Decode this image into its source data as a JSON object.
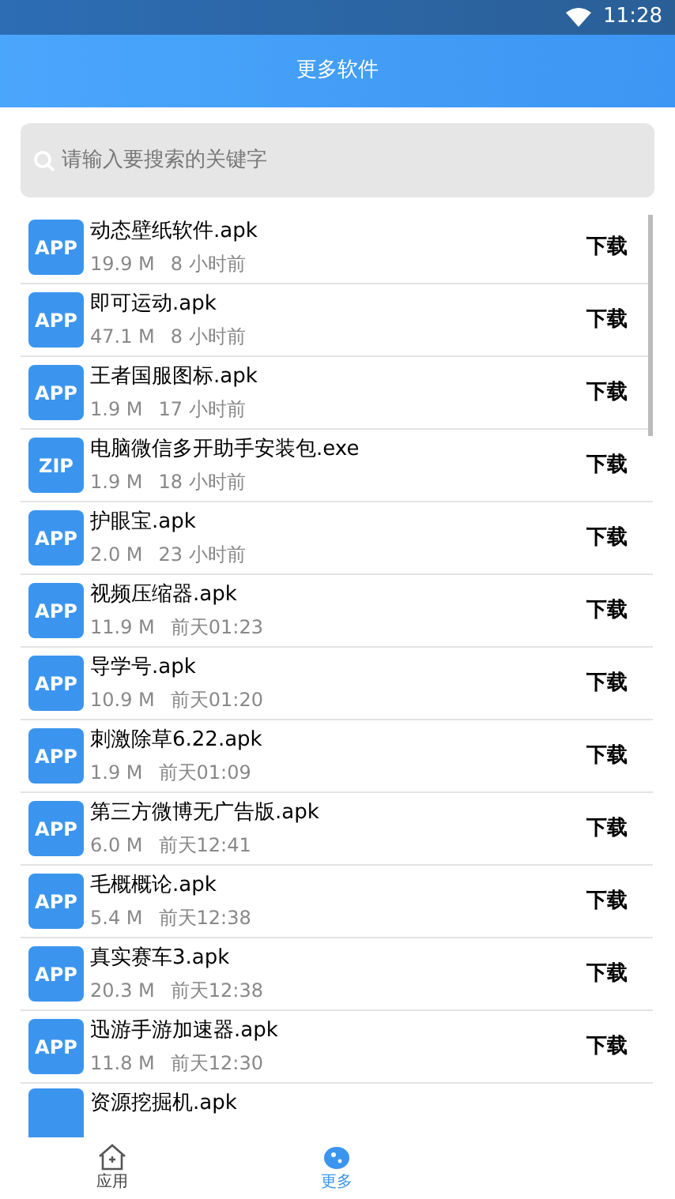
{
  "status_bar": {
    "time": "11:28"
  },
  "header": {
    "title": "更多软件"
  },
  "search": {
    "placeholder": "请输入要搜索的关键字"
  },
  "files": [
    {
      "badge": "APP",
      "name": "动态壁纸软件.apk",
      "size": "19.9 M",
      "time": "8 小时前",
      "action": "下载"
    },
    {
      "badge": "APP",
      "name": "即可运动.apk",
      "size": "47.1 M",
      "time": "8 小时前",
      "action": "下载"
    },
    {
      "badge": "APP",
      "name": "王者国服图标.apk",
      "size": "1.9 M",
      "time": "17 小时前",
      "action": "下载"
    },
    {
      "badge": "ZIP",
      "name": "电脑微信多开助手安装包.exe",
      "size": "1.9 M",
      "time": "18 小时前",
      "action": "下载"
    },
    {
      "badge": "APP",
      "name": "护眼宝.apk",
      "size": "2.0 M",
      "time": "23 小时前",
      "action": "下载"
    },
    {
      "badge": "APP",
      "name": "视频压缩器.apk",
      "size": "11.9 M",
      "time": "前天01:23",
      "action": "下载"
    },
    {
      "badge": "APP",
      "name": "导学号.apk",
      "size": "10.9 M",
      "time": "前天01:20",
      "action": "下载"
    },
    {
      "badge": "APP",
      "name": "刺激除草6.22.apk",
      "size": "1.9 M",
      "time": "前天01:09",
      "action": "下载"
    },
    {
      "badge": "APP",
      "name": "第三方微博无广告版.apk",
      "size": "6.0 M",
      "time": "前天12:41",
      "action": "下载"
    },
    {
      "badge": "APP",
      "name": "毛概概论.apk",
      "size": "5.4 M",
      "time": "前天12:38",
      "action": "下载"
    },
    {
      "badge": "APP",
      "name": "真实赛车3.apk",
      "size": "20.3 M",
      "time": "前天12:38",
      "action": "下载"
    },
    {
      "badge": "APP",
      "name": "迅游手游加速器.apk",
      "size": "11.8 M",
      "time": "前天12:30",
      "action": "下载"
    }
  ],
  "partial_file": {
    "name": "资源挖掘机.apk"
  },
  "tabs": [
    {
      "kind": "home",
      "label": "应用",
      "selected": false
    },
    {
      "kind": "more",
      "label": "更多",
      "selected": true
    }
  ]
}
